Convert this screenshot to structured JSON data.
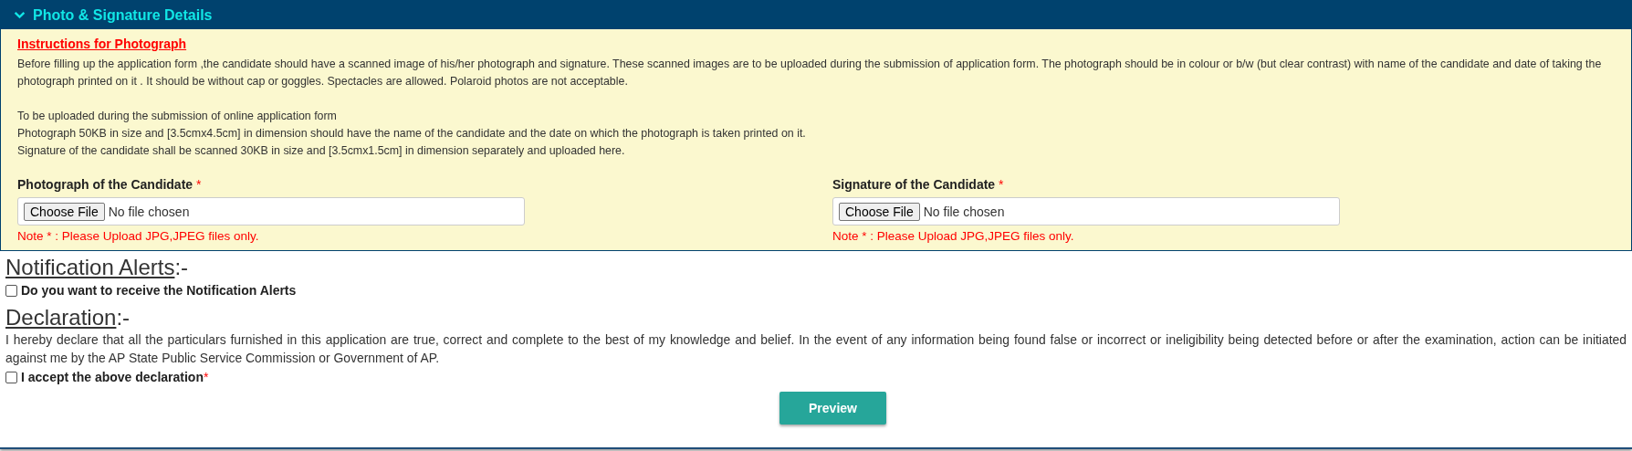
{
  "section": {
    "title": "Photo & Signature Details",
    "expanded": true
  },
  "instructions": {
    "heading": "Instructions for Photograph",
    "blocks": [
      {
        "lines": [
          "Before filling up the application form ,the candidate should have a scanned image of his/her photograph and signature. These scanned images are to be uploaded during the submission of application form. The photograph should be in colour or b/w (but clear contrast) with name of the candidate and date of taking the photograph printed on it . It should be without cap or goggles. Spectacles are allowed. Polaroid photos are not acceptable."
        ]
      },
      {
        "lines": [
          "To be uploaded during the submission of online application form",
          "Photograph 50KB in size and [3.5cmx4.5cm] in dimension should have the name of the candidate and the date on which the photograph is taken printed on it.",
          "Signature of the candidate shall be scanned 30KB in size and [3.5cmx1.5cm] in dimension separately and uploaded here."
        ]
      }
    ]
  },
  "uploads": [
    {
      "label": "Photograph of the Candidate",
      "required_mark": "*",
      "button": "Choose File",
      "status": "No file chosen",
      "note": "Note * : Please Upload JPG,JPEG files only."
    },
    {
      "label": "Signature of the Candidate",
      "required_mark": "*",
      "button": "Choose File",
      "status": "No file chosen",
      "note": "Note * : Please Upload JPG,JPEG files only."
    }
  ],
  "notification": {
    "heading": "Notification Alerts",
    "suffix": ":-",
    "option": {
      "label": "Do you want to receive the Notification Alerts",
      "checked": false
    }
  },
  "declaration": {
    "heading": "Declaration",
    "suffix": ":-",
    "text": "I hereby declare that all the particulars furnished in this application are true, correct and complete to the best of my knowledge and belief. In the event of any information being found false or incorrect or ineligibility being detected before or after the examination, action can be initiated against me by the AP State Public Service Commission or Government of AP.",
    "option": {
      "label": "I accept the above declaration",
      "required_mark": "*",
      "checked": false
    }
  },
  "preview_button": "Preview"
}
